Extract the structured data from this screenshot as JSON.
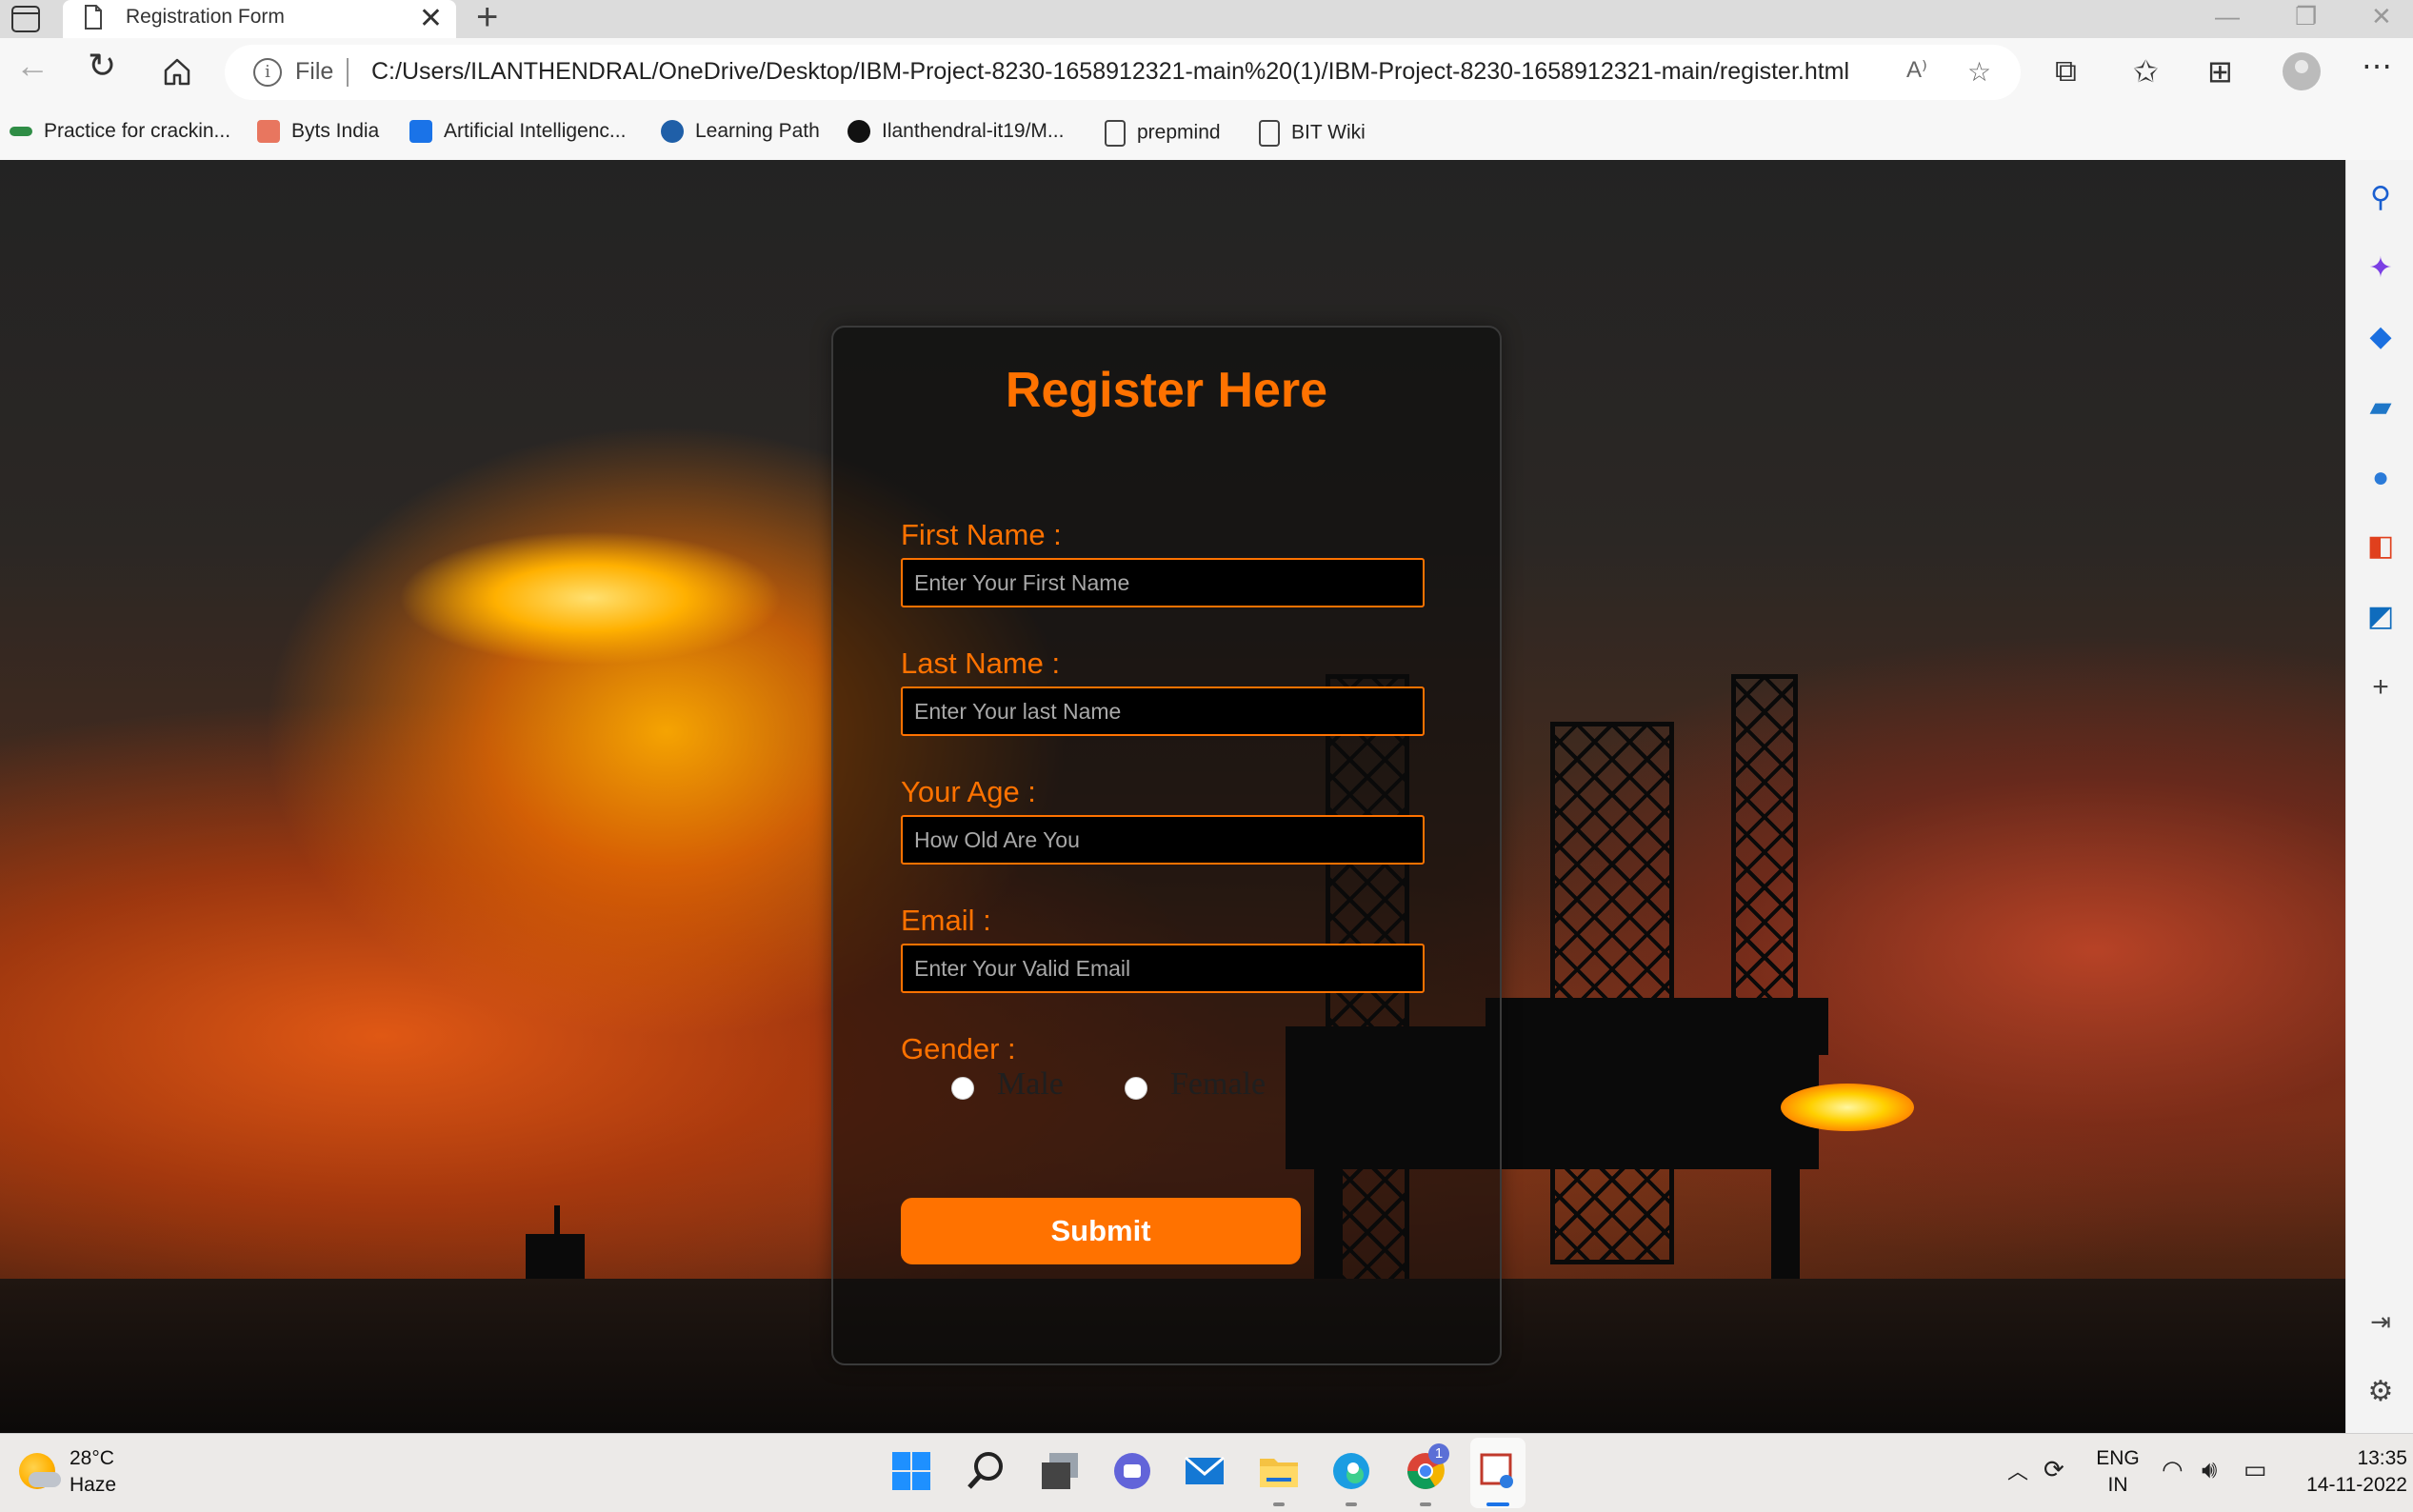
{
  "browser": {
    "tab": {
      "title": "Registration Form",
      "close_glyph": "✕"
    },
    "new_tab_glyph": "+",
    "window_controls": {
      "minimize": "—",
      "maximize": "❐",
      "close": "✕"
    },
    "address_bar": {
      "scheme_label": "File",
      "url": "C:/Users/ILANTHENDRAL/OneDrive/Desktop/IBM-Project-8230-1658912321-main%20(1)/IBM-Project-8230-1658912321-main/register.html"
    },
    "favorites": [
      {
        "label": "Practice for crackin...",
        "icon": "geeksforgeeks-icon",
        "color": "#2f8d46"
      },
      {
        "label": "Byts India",
        "icon": "byts-icon",
        "color": "#e8765f"
      },
      {
        "label": "Artificial Intelligenc...",
        "icon": "edureka-icon",
        "color": "#1a73e8"
      },
      {
        "label": "Learning Path",
        "icon": "learning-path-icon",
        "color": "#1f5fa8"
      },
      {
        "label": "Ilanthendral-it19/M...",
        "icon": "github-icon",
        "color": "#111111"
      },
      {
        "label": "prepmind",
        "icon": "document-icon",
        "color": "#444444"
      },
      {
        "label": "BIT Wiki",
        "icon": "document-icon",
        "color": "#444444"
      }
    ]
  },
  "form": {
    "title": "Register Here",
    "fields": [
      {
        "label": "First Name :",
        "placeholder": "Enter Your First Name",
        "value": ""
      },
      {
        "label": "Last Name :",
        "placeholder": "Enter Your last Name",
        "value": ""
      },
      {
        "label": "Your Age :",
        "placeholder": "How Old Are You",
        "value": ""
      },
      {
        "label": "Email :",
        "placeholder": "Enter Your Valid Email",
        "value": ""
      }
    ],
    "gender": {
      "label": "Gender :",
      "options": [
        "Male",
        "Female"
      ],
      "selected": null
    },
    "submit_label": "Submit",
    "accent_color": "#ff7200"
  },
  "taskbar": {
    "weather": {
      "temperature": "28°C",
      "condition": "Haze"
    },
    "apps": [
      "windows-start-icon",
      "search-icon",
      "task-view-icon",
      "teams-chat-icon",
      "mail-icon",
      "file-explorer-icon",
      "edge-icon",
      "chrome-icon",
      "snipping-tool-icon"
    ],
    "chrome_badge": "1",
    "language": {
      "line1": "ENG",
      "line2": "IN"
    },
    "clock": {
      "time": "13:35",
      "date": "14-11-2022"
    }
  }
}
